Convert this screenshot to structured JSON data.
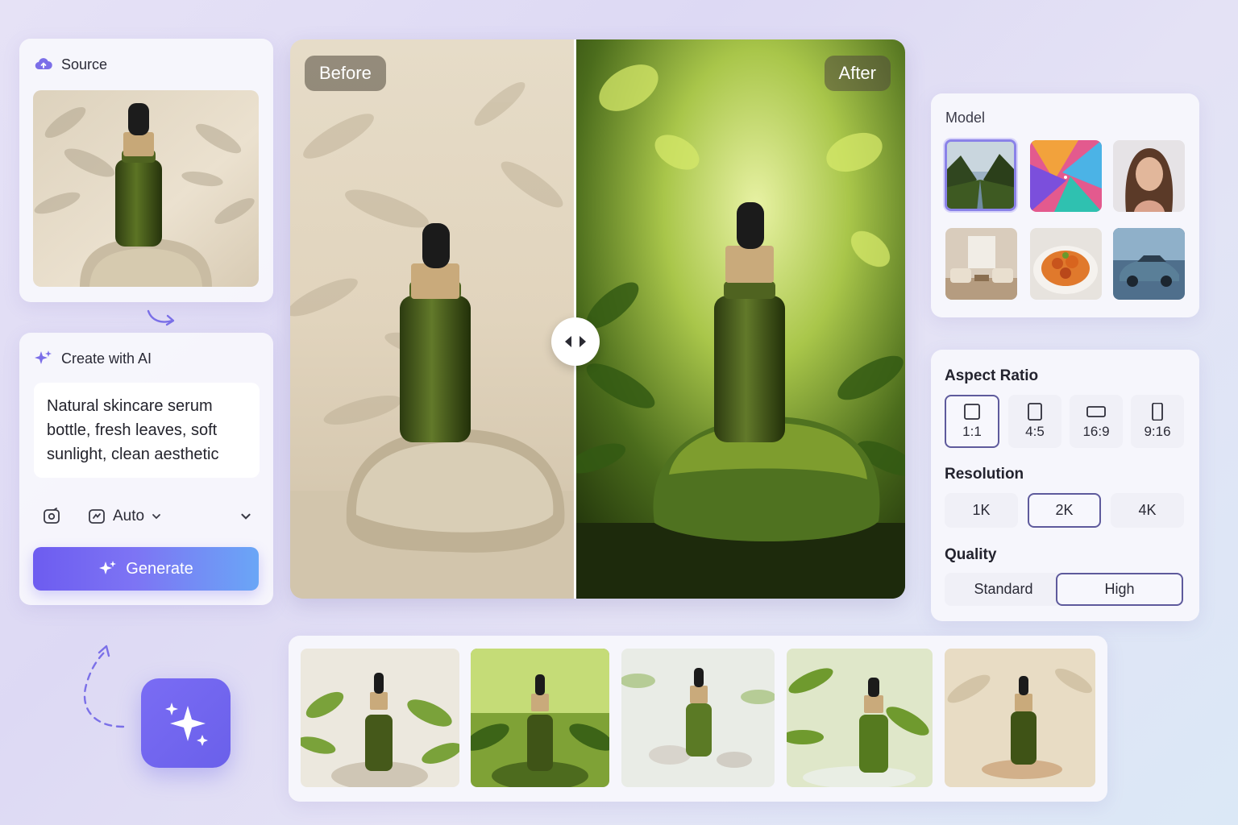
{
  "source": {
    "title": "Source",
    "image": "serum bottle on stone, shadow of leaves"
  },
  "create": {
    "title": "Create with AI",
    "prompt": "Natural skincare serum bottle, fresh leaves, soft sunlight, clean aesthetic",
    "mode_label": "Auto",
    "generate_label": "Generate"
  },
  "compare": {
    "before_label": "Before",
    "after_label": "After"
  },
  "model": {
    "title": "Model",
    "items": [
      "landscape-valley",
      "abstract-colorful",
      "portrait-woman",
      "interior-living-room",
      "food-dish",
      "car"
    ],
    "selected_index": 0
  },
  "settings": {
    "aspect_ratio": {
      "title": "Aspect Ratio",
      "options": [
        "1:1",
        "4:5",
        "16:9",
        "9:16"
      ],
      "selected": "1:1"
    },
    "resolution": {
      "title": "Resolution",
      "options": [
        "1K",
        "2K",
        "4K"
      ],
      "selected": "2K"
    },
    "quality": {
      "title": "Quality",
      "options": [
        "Standard",
        "High"
      ],
      "selected": "High"
    }
  },
  "gallery": {
    "count": 5
  },
  "colors": {
    "accent": "#6d5cf0",
    "accent_light": "#6aa6f6",
    "selected_border": "#5e5a9c"
  }
}
